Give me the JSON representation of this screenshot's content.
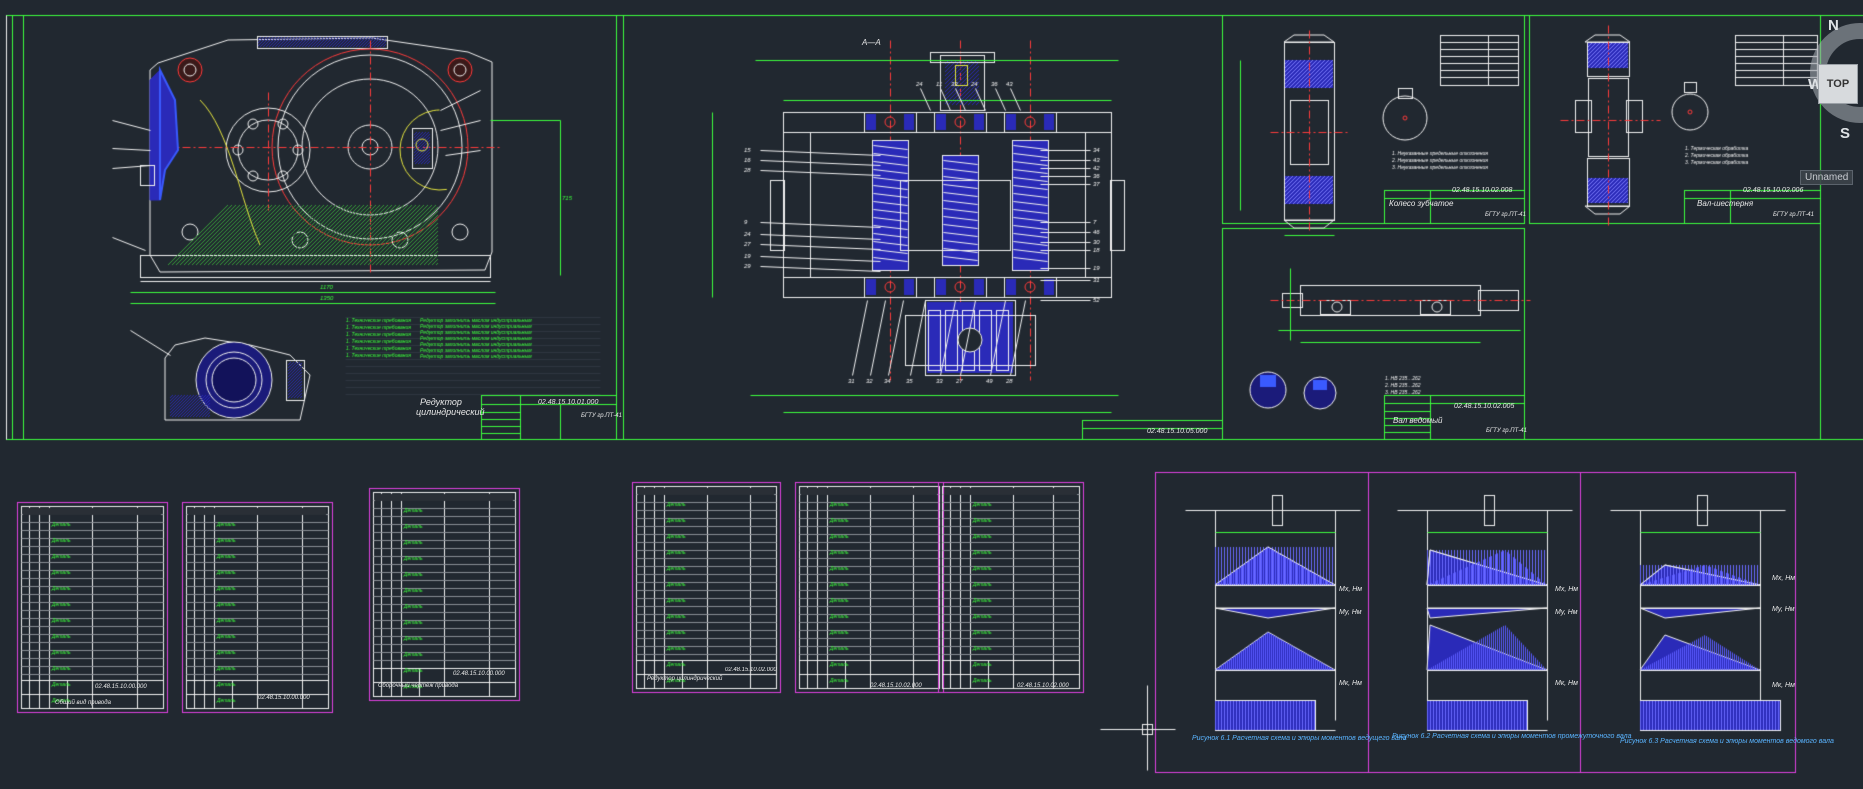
{
  "viewcube": {
    "north": "N",
    "west": "W",
    "south": "S",
    "top_face": "TOP"
  },
  "ucs": {
    "name": "Unnamed"
  },
  "sheets": {
    "assembly_side": {
      "code": "02.48.15.10.01.000",
      "title_line1": "Редуктор",
      "title_line2": "цилиндрический",
      "group": "БГТУ гр.ПТ-41"
    },
    "assembly_section": {
      "code": "02.48.15.10.05.000",
      "section_label": "A—A"
    },
    "gear_wheel": {
      "code": "02.48.15.10.02.008",
      "title": "Колесо зубчатое",
      "group": "БГТУ гр.ПТ-41"
    },
    "gear_shaft": {
      "code": "02.48.15.10.02.006",
      "title": "Вал-шестерня",
      "group": "БГТУ гр.ПТ-41"
    },
    "shaft": {
      "code": "02.48.15.10.02.005",
      "title": "Вал ведомый",
      "group": "БГТУ гр.ПТ-41"
    }
  },
  "specs": [
    {
      "code": "02.48.15.10.00.000",
      "title": "Общий вид привода"
    },
    {
      "code": "02.48.15.10.00.000",
      "title": ""
    },
    {
      "code": "02.48.15.10.00.000",
      "title": "Сборочный чертеж привода"
    },
    {
      "code": "02.48.15.10.02.000",
      "title": "Редуктор цилиндрический"
    },
    {
      "code": "02.48.15.10.02.000",
      "title": ""
    },
    {
      "code": "02.48.15.10.02.000",
      "title": ""
    }
  ],
  "diagrams": {
    "caption1": "Рисунок 6.1 Расчетная схема и эпюры моментов ведущего вала",
    "caption2": "Рисунок 6.2 Расчетная схема и эпюры моментов промежуточного вала",
    "caption3": "Рисунок 6.3 Расчетная схема и эпюры моментов ведомого вала",
    "labels": {
      "mx": "Mx, Нм",
      "my": "My, Нм",
      "mk": "Mк, Нм"
    }
  },
  "colors": {
    "background": "#212830",
    "frame": "#3cff3c",
    "geometry": "#f2f2f2",
    "center": "#ff3b3b",
    "hatch": "#2a2ab8",
    "dim": "#4ad84a",
    "magenta": "#e040e0",
    "yellow": "#e6e640",
    "cyan": "#3fe6e6"
  }
}
